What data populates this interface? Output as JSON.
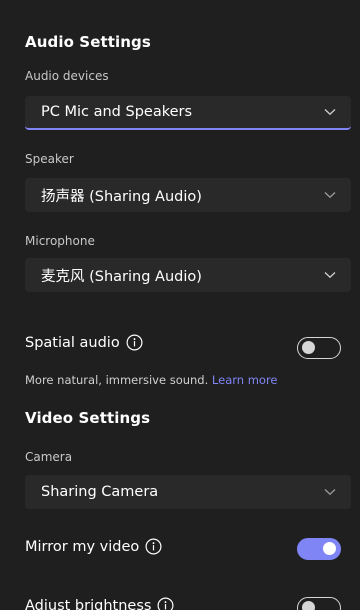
{
  "audio": {
    "title": "Audio Settings",
    "devices_label": "Audio devices",
    "devices_value": "PC Mic and Speakers",
    "speaker_label": "Speaker",
    "speaker_value": "扬声器 (Sharing Audio)",
    "microphone_label": "Microphone",
    "microphone_value": "麦克风 (Sharing Audio)",
    "spatial_label": "Spatial audio",
    "spatial_on": false,
    "spatial_description": "More natural, immersive sound.",
    "learn_more": "Learn more"
  },
  "video": {
    "title": "Video Settings",
    "camera_label": "Camera",
    "camera_value": "Sharing Camera",
    "mirror_label": "Mirror my video",
    "mirror_on": true,
    "brightness_label": "Adjust brightness",
    "brightness_on": false
  },
  "colors": {
    "background": "#1f1f1f",
    "field": "#292929",
    "accent": "#7f85f5"
  },
  "icons": {
    "dropdown": "chevron-down-icon",
    "info": "info-icon"
  }
}
